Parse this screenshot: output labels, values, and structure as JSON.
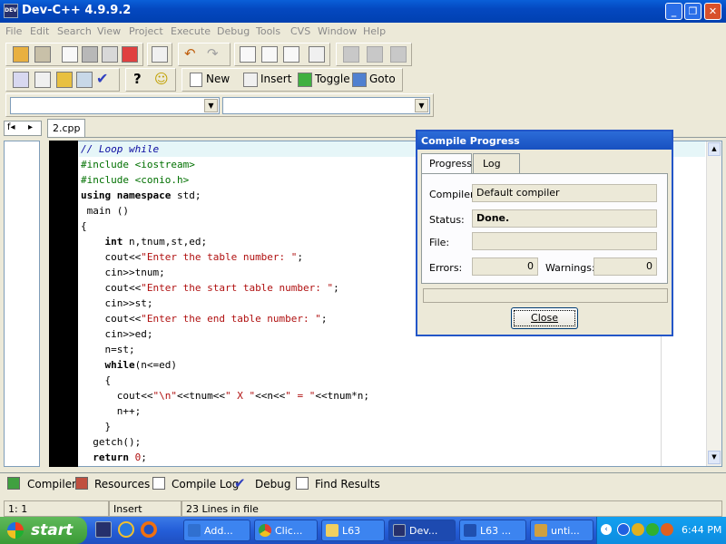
{
  "window": {
    "title": "Dev-C++ 4.9.9.2",
    "app_icon_text": "DEV"
  },
  "menu": [
    "File",
    "Edit",
    "Search",
    "View",
    "Project",
    "Execute",
    "Debug",
    "Tools",
    "CVS",
    "Window",
    "Help"
  ],
  "toolbar": {
    "new_label": "New",
    "insert_label": "Insert",
    "toggle_label": "Toggle",
    "goto_label": "Goto"
  },
  "editor": {
    "tab": "2.cpp",
    "lines": [
      [
        {
          "t": "// Loop while",
          "c": "cm"
        }
      ],
      [
        {
          "t": "#include <iostream>",
          "c": "pp"
        }
      ],
      [
        {
          "t": "#include <conio.h>",
          "c": "pp"
        }
      ],
      [
        {
          "t": "using namespace",
          "c": "kw"
        },
        {
          "t": " std;",
          "c": ""
        }
      ],
      [
        {
          "t": " main ()",
          "c": ""
        }
      ],
      [
        {
          "t": "{",
          "c": ""
        }
      ],
      [
        {
          "t": "    ",
          "c": ""
        },
        {
          "t": "int",
          "c": "kw"
        },
        {
          "t": " n,tnum,st,ed;",
          "c": ""
        }
      ],
      [
        {
          "t": "    cout<<",
          "c": ""
        },
        {
          "t": "\"Enter the table number: \"",
          "c": "st"
        },
        {
          "t": ";",
          "c": ""
        }
      ],
      [
        {
          "t": "    cin>>tnum;",
          "c": ""
        }
      ],
      [
        {
          "t": "    cout<<",
          "c": ""
        },
        {
          "t": "\"Enter the start table number: \"",
          "c": "st"
        },
        {
          "t": ";",
          "c": ""
        }
      ],
      [
        {
          "t": "    cin>>st;",
          "c": ""
        }
      ],
      [
        {
          "t": "    cout<<",
          "c": ""
        },
        {
          "t": "\"Enter the end table number: \"",
          "c": "st"
        },
        {
          "t": ";",
          "c": ""
        }
      ],
      [
        {
          "t": "    cin>>ed;",
          "c": ""
        }
      ],
      [
        {
          "t": "    n=st;",
          "c": ""
        }
      ],
      [
        {
          "t": "    ",
          "c": ""
        },
        {
          "t": "while",
          "c": "kw"
        },
        {
          "t": "(n<=ed)",
          "c": ""
        }
      ],
      [
        {
          "t": "    {",
          "c": ""
        }
      ],
      [
        {
          "t": "      cout<<",
          "c": ""
        },
        {
          "t": "\"\\n\"",
          "c": "st"
        },
        {
          "t": "<<tnum<<",
          "c": ""
        },
        {
          "t": "\" X \"",
          "c": "st"
        },
        {
          "t": "<<n<<",
          "c": ""
        },
        {
          "t": "\" = \"",
          "c": "st"
        },
        {
          "t": "<<tnum*n;",
          "c": ""
        }
      ],
      [
        {
          "t": "      n++;",
          "c": ""
        }
      ],
      [
        {
          "t": "    }",
          "c": ""
        }
      ],
      [
        {
          "t": "  getch();",
          "c": ""
        }
      ],
      [
        {
          "t": "  ",
          "c": ""
        },
        {
          "t": "return",
          "c": "kw"
        },
        {
          "t": " ",
          "c": ""
        },
        {
          "t": "0",
          "c": "nm"
        },
        {
          "t": ";",
          "c": ""
        }
      ]
    ]
  },
  "dialog": {
    "title": "Compile Progress",
    "tabs": [
      "Progress",
      "Log"
    ],
    "compiler_label": "Compiler:",
    "compiler_value": "Default compiler",
    "status_label": "Status:",
    "status_value": "Done.",
    "file_label": "File:",
    "file_value": "",
    "errors_label": "Errors:",
    "errors_value": "0",
    "warnings_label": "Warnings:",
    "warnings_value": "0",
    "close_label": "Close"
  },
  "bottom_tabs": [
    "Compiler",
    "Resources",
    "Compile Log",
    "Debug",
    "Find Results"
  ],
  "status": {
    "position": "1: 1",
    "mode": "Insert",
    "lines": "23 Lines in file"
  },
  "taskbar": {
    "start": "start",
    "items": [
      "Add...",
      "Clic...",
      "L63",
      "Dev...",
      "L63 ...",
      "unti..."
    ],
    "clock": "6:44 PM"
  },
  "colors": {
    "titlebar": "#0448c0",
    "taskbar": "#245ed8",
    "start": "#3a9a35",
    "comment": "#0a0aa0",
    "string": "#b01010",
    "preproc": "#007000"
  }
}
